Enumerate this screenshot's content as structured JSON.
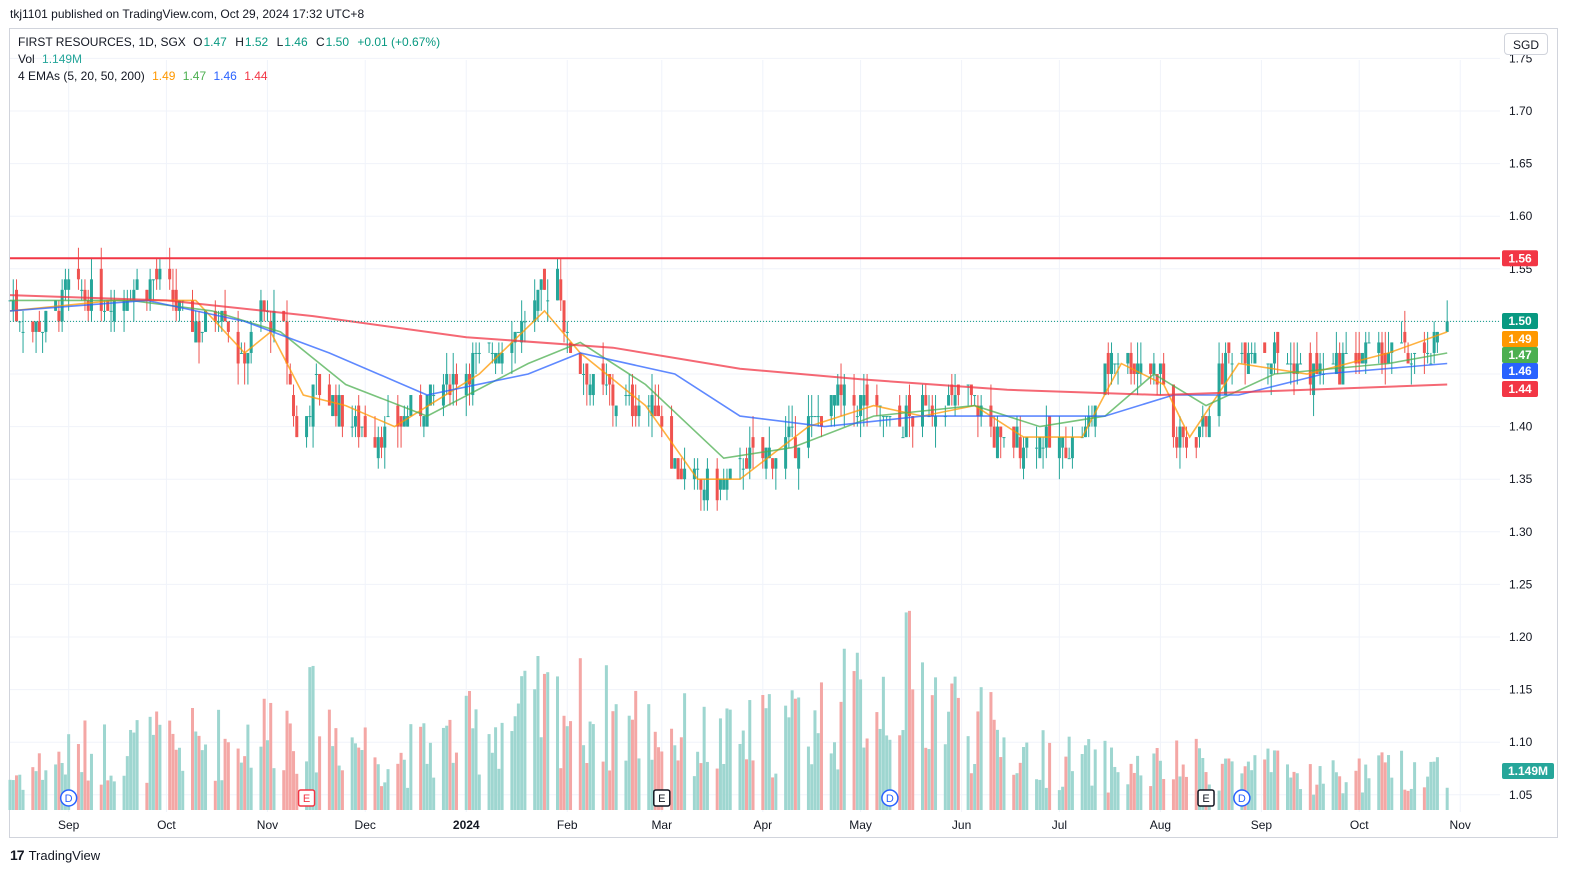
{
  "header": {
    "published_line": "tkj1101 published on TradingView.com, Oct 29, 2024 17:32 UTC+8"
  },
  "legend": {
    "symbol_line": "FIRST RESOURCES, 1D, SGX",
    "ohlc": {
      "o_label": "O",
      "o_value": "1.47",
      "h_label": "H",
      "h_value": "1.52",
      "l_label": "L",
      "l_value": "1.46",
      "c_label": "C",
      "c_value": "1.50",
      "change": "+0.01 (+0.67%)"
    },
    "vol_label": "Vol",
    "vol_value": "1.149M",
    "ema_label": "4 EMAs (5, 20, 50, 200)",
    "ema_values": [
      "1.49",
      "1.47",
      "1.46",
      "1.44"
    ]
  },
  "currency_button": "SGD",
  "footer": {
    "logo": "17",
    "brand": "TradingView"
  },
  "colors": {
    "up": "#26a69a",
    "down": "#ef5350",
    "ema5": "#ff9800",
    "ema20": "#4caf50",
    "ema50": "#2962ff",
    "ema200": "#f23645",
    "resistance": "#f23645",
    "grid": "#f0f3fa",
    "current_price_line": "#089981"
  },
  "icons": {
    "dividend": "dividend-marker-icon",
    "earnings": "earnings-marker-icon",
    "logo": "tradingview-logo-icon"
  },
  "chart_data": {
    "type": "candlestick",
    "title": "FIRST RESOURCES, 1D, SGX",
    "currency": "SGD",
    "y_ticks": [
      "1.75",
      "1.70",
      "1.65",
      "1.60",
      "1.55",
      "1.50",
      "1.45",
      "1.40",
      "1.35",
      "1.30",
      "1.25",
      "1.20",
      "1.15",
      "1.10",
      "1.05"
    ],
    "y_tick_values": [
      1.75,
      1.7,
      1.65,
      1.6,
      1.55,
      1.5,
      1.45,
      1.4,
      1.35,
      1.3,
      1.25,
      1.2,
      1.15,
      1.1,
      1.05
    ],
    "ylim": [
      1.03,
      1.78
    ],
    "x_ticks": [
      "Sep",
      "Oct",
      "Nov",
      "Dec",
      "2024",
      "Feb",
      "Mar",
      "Apr",
      "May",
      "Jun",
      "Jul",
      "Aug",
      "Sep",
      "Oct",
      "Nov"
    ],
    "x_tick_dates": [
      "2023-09-01",
      "2023-10-01",
      "2023-11-01",
      "2023-12-01",
      "2024-01-01",
      "2024-02-01",
      "2024-03-01",
      "2024-04-01",
      "2024-05-01",
      "2024-06-01",
      "2024-07-01",
      "2024-08-01",
      "2024-09-01",
      "2024-10-01",
      "2024-11-01"
    ],
    "xlim": [
      "2023-08-14",
      "2024-11-04"
    ],
    "horizontal_line": {
      "value": 1.56,
      "label": "1.56"
    },
    "price_labels": [
      {
        "value": 1.5,
        "text": "1.50",
        "color": "#089981"
      },
      {
        "value": 1.49,
        "text": "1.49",
        "color": "#ff9800"
      },
      {
        "value": 1.47,
        "text": "1.47",
        "color": "#4caf50"
      },
      {
        "value": 1.46,
        "text": "1.46",
        "color": "#2962ff"
      },
      {
        "value": 1.44,
        "text": "1.44",
        "color": "#f23645"
      }
    ],
    "volume_label": "1.149M",
    "close_path": [
      [
        "2023-08-14",
        1.52
      ],
      [
        "2023-08-21",
        1.49
      ],
      [
        "2023-08-28",
        1.51
      ],
      [
        "2023-09-01",
        1.53
      ],
      [
        "2023-09-11",
        1.52
      ],
      [
        "2023-09-20",
        1.53
      ],
      [
        "2023-09-28",
        1.54
      ],
      [
        "2023-10-05",
        1.51
      ],
      [
        "2023-10-12",
        1.49
      ],
      [
        "2023-10-18",
        1.52
      ],
      [
        "2023-10-24",
        1.46
      ],
      [
        "2023-10-30",
        1.51
      ],
      [
        "2023-11-06",
        1.49
      ],
      [
        "2023-11-10",
        1.39
      ],
      [
        "2023-11-16",
        1.44
      ],
      [
        "2023-11-22",
        1.42
      ],
      [
        "2023-11-29",
        1.4
      ],
      [
        "2023-12-07",
        1.39
      ],
      [
        "2023-12-14",
        1.41
      ],
      [
        "2023-12-22",
        1.43
      ],
      [
        "2024-01-03",
        1.46
      ],
      [
        "2024-01-12",
        1.48
      ],
      [
        "2024-01-22",
        1.51
      ],
      [
        "2024-01-29",
        1.55
      ],
      [
        "2024-02-01",
        1.48
      ],
      [
        "2024-02-09",
        1.44
      ],
      [
        "2024-02-19",
        1.42
      ],
      [
        "2024-02-28",
        1.42
      ],
      [
        "2024-03-06",
        1.36
      ],
      [
        "2024-03-14",
        1.34
      ],
      [
        "2024-03-22",
        1.35
      ],
      [
        "2024-03-28",
        1.37
      ],
      [
        "2024-04-08",
        1.38
      ],
      [
        "2024-04-18",
        1.41
      ],
      [
        "2024-04-26",
        1.43
      ],
      [
        "2024-05-03",
        1.42
      ],
      [
        "2024-05-10",
        1.4
      ],
      [
        "2024-05-17",
        1.41
      ],
      [
        "2024-05-27",
        1.42
      ],
      [
        "2024-06-04",
        1.43
      ],
      [
        "2024-06-13",
        1.38
      ],
      [
        "2024-06-24",
        1.39
      ],
      [
        "2024-07-02",
        1.38
      ],
      [
        "2024-07-10",
        1.4
      ],
      [
        "2024-07-17",
        1.47
      ],
      [
        "2024-07-26",
        1.46
      ],
      [
        "2024-08-01",
        1.45
      ],
      [
        "2024-08-06",
        1.38
      ],
      [
        "2024-08-14",
        1.4
      ],
      [
        "2024-08-22",
        1.47
      ],
      [
        "2024-08-30",
        1.48
      ],
      [
        "2024-09-09",
        1.46
      ],
      [
        "2024-09-18",
        1.45
      ],
      [
        "2024-09-26",
        1.46
      ],
      [
        "2024-10-04",
        1.47
      ],
      [
        "2024-10-14",
        1.47
      ],
      [
        "2024-10-22",
        1.46
      ],
      [
        "2024-10-28",
        1.5
      ]
    ],
    "ema_series": [
      {
        "name": "EMA 5",
        "color": "#ff9800",
        "points": [
          [
            "2023-08-14",
            1.51
          ],
          [
            "2023-09-15",
            1.52
          ],
          [
            "2023-10-10",
            1.52
          ],
          [
            "2023-10-25",
            1.47
          ],
          [
            "2023-11-02",
            1.49
          ],
          [
            "2023-11-12",
            1.43
          ],
          [
            "2023-11-25",
            1.42
          ],
          [
            "2023-12-10",
            1.4
          ],
          [
            "2024-01-05",
            1.45
          ],
          [
            "2024-01-25",
            1.51
          ],
          [
            "2024-02-05",
            1.47
          ],
          [
            "2024-02-25",
            1.42
          ],
          [
            "2024-03-12",
            1.35
          ],
          [
            "2024-03-25",
            1.35
          ],
          [
            "2024-04-15",
            1.4
          ],
          [
            "2024-05-05",
            1.42
          ],
          [
            "2024-05-20",
            1.41
          ],
          [
            "2024-06-05",
            1.42
          ],
          [
            "2024-06-20",
            1.39
          ],
          [
            "2024-07-08",
            1.39
          ],
          [
            "2024-07-20",
            1.46
          ],
          [
            "2024-08-02",
            1.44
          ],
          [
            "2024-08-10",
            1.39
          ],
          [
            "2024-08-25",
            1.46
          ],
          [
            "2024-09-15",
            1.45
          ],
          [
            "2024-10-10",
            1.47
          ],
          [
            "2024-10-28",
            1.49
          ]
        ]
      },
      {
        "name": "EMA 20",
        "color": "#4caf50",
        "points": [
          [
            "2023-08-14",
            1.52
          ],
          [
            "2023-09-20",
            1.52
          ],
          [
            "2023-10-15",
            1.51
          ],
          [
            "2023-11-05",
            1.49
          ],
          [
            "2023-11-25",
            1.44
          ],
          [
            "2023-12-20",
            1.41
          ],
          [
            "2024-01-20",
            1.46
          ],
          [
            "2024-02-05",
            1.48
          ],
          [
            "2024-02-25",
            1.44
          ],
          [
            "2024-03-20",
            1.37
          ],
          [
            "2024-04-10",
            1.38
          ],
          [
            "2024-05-05",
            1.41
          ],
          [
            "2024-06-05",
            1.42
          ],
          [
            "2024-06-25",
            1.4
          ],
          [
            "2024-07-15",
            1.41
          ],
          [
            "2024-07-30",
            1.45
          ],
          [
            "2024-08-15",
            1.42
          ],
          [
            "2024-09-05",
            1.45
          ],
          [
            "2024-10-10",
            1.46
          ],
          [
            "2024-10-28",
            1.47
          ]
        ]
      },
      {
        "name": "EMA 50",
        "color": "#2962ff",
        "points": [
          [
            "2023-08-14",
            1.51
          ],
          [
            "2023-09-25",
            1.52
          ],
          [
            "2023-10-25",
            1.5
          ],
          [
            "2023-11-20",
            1.47
          ],
          [
            "2023-12-20",
            1.43
          ],
          [
            "2024-01-20",
            1.45
          ],
          [
            "2024-02-05",
            1.47
          ],
          [
            "2024-03-05",
            1.45
          ],
          [
            "2024-03-25",
            1.41
          ],
          [
            "2024-04-20",
            1.4
          ],
          [
            "2024-05-20",
            1.41
          ],
          [
            "2024-06-20",
            1.41
          ],
          [
            "2024-07-15",
            1.41
          ],
          [
            "2024-08-05",
            1.43
          ],
          [
            "2024-08-25",
            1.43
          ],
          [
            "2024-09-20",
            1.45
          ],
          [
            "2024-10-28",
            1.46
          ]
        ]
      },
      {
        "name": "EMA 200",
        "color": "#f23645",
        "points": [
          [
            "2023-08-14",
            1.525
          ],
          [
            "2023-10-01",
            1.52
          ],
          [
            "2023-11-15",
            1.505
          ],
          [
            "2024-01-01",
            1.485
          ],
          [
            "2024-02-15",
            1.475
          ],
          [
            "2024-03-25",
            1.455
          ],
          [
            "2024-05-01",
            1.445
          ],
          [
            "2024-06-15",
            1.435
          ],
          [
            "2024-08-01",
            1.43
          ],
          [
            "2024-09-15",
            1.435
          ],
          [
            "2024-10-28",
            1.44
          ]
        ]
      }
    ],
    "volume_profile": [
      [
        "2023-08-14",
        0.9
      ],
      [
        "2023-09-05",
        1.6
      ],
      [
        "2023-10-20",
        1.9
      ],
      [
        "2023-11-13",
        2.6
      ],
      [
        "2023-12-10",
        1.4
      ],
      [
        "2024-01-29",
        2.9
      ],
      [
        "2024-03-20",
        1.8
      ],
      [
        "2024-04-20",
        2.6
      ],
      [
        "2024-05-15",
        3.6
      ],
      [
        "2024-06-20",
        1.5
      ],
      [
        "2024-07-25",
        1.1
      ],
      [
        "2024-08-15",
        1.3
      ],
      [
        "2024-09-20",
        0.9
      ],
      [
        "2024-10-28",
        1.2
      ]
    ],
    "event_markers": [
      {
        "date": "2023-09-01",
        "label": "D",
        "kind": "dividend"
      },
      {
        "date": "2023-11-13",
        "label": "E",
        "kind": "earnings"
      },
      {
        "date": "2024-03-01",
        "label": "E",
        "kind": "earnings"
      },
      {
        "date": "2024-05-10",
        "label": "D",
        "kind": "dividend"
      },
      {
        "date": "2024-08-15",
        "label": "E",
        "kind": "earnings"
      },
      {
        "date": "2024-08-26",
        "label": "D",
        "kind": "dividend"
      }
    ]
  }
}
